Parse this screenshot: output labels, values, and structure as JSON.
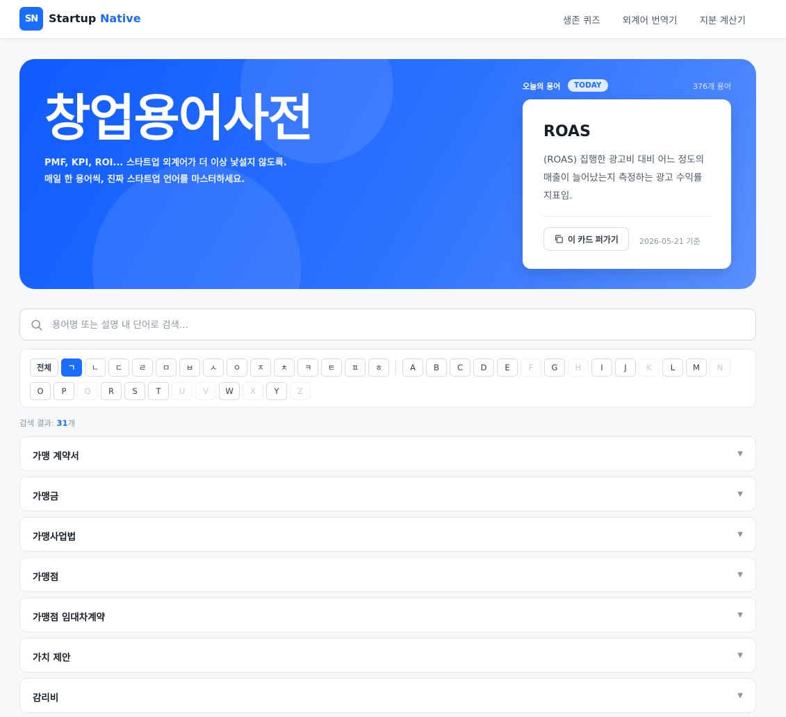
{
  "header": {
    "logo_text": "SN",
    "brand_main": "Startup",
    "brand_accent": "Native",
    "nav": [
      "생존 퀴즈",
      "외계어 번역기",
      "지분 계산기"
    ]
  },
  "hero": {
    "title": "창업용어사전",
    "subtitle_line1": "PMF, KPI, ROI... 스타트업 외계어가 더 이상 낯설지 않도록.",
    "subtitle_line2": "매일 한 용어씩, 진짜 스타트업 언어를 마스터하세요.",
    "today_label": "오늘의 용어",
    "today_badge": "TODAY",
    "term_count": "376개 용어",
    "card": {
      "term": "ROAS",
      "description": "(ROAS) 집행한 광고비 대비 어느 정도의 매출이 늘어났는지 측정하는 광고 수익률 지표임.",
      "share_label": "이 카드 퍼가기",
      "date": "2026-05-21 기준"
    }
  },
  "search": {
    "placeholder": "용어명 또는 설명 내 단어로 검색...",
    "value": ""
  },
  "filters": {
    "all_label": "전체",
    "selected": "ㄱ",
    "korean": [
      "ㄱ",
      "ㄴ",
      "ㄷ",
      "ㄹ",
      "ㅁ",
      "ㅂ",
      "ㅅ",
      "ㅇ",
      "ㅈ",
      "ㅊ",
      "ㅋ",
      "ㅌ",
      "ㅍ",
      "ㅎ"
    ],
    "alpha_row1": [
      {
        "l": "A",
        "on": true
      },
      {
        "l": "B",
        "on": true
      },
      {
        "l": "C",
        "on": true
      },
      {
        "l": "D",
        "on": true
      },
      {
        "l": "E",
        "on": true
      },
      {
        "l": "F",
        "on": false
      },
      {
        "l": "G",
        "on": true
      },
      {
        "l": "H",
        "on": false
      },
      {
        "l": "I",
        "on": true
      },
      {
        "l": "J",
        "on": true
      },
      {
        "l": "K",
        "on": false
      },
      {
        "l": "L",
        "on": true
      },
      {
        "l": "M",
        "on": true
      },
      {
        "l": "N",
        "on": false
      }
    ],
    "alpha_row2": [
      {
        "l": "O",
        "on": true
      },
      {
        "l": "P",
        "on": true
      },
      {
        "l": "Q",
        "on": false
      },
      {
        "l": "R",
        "on": true
      },
      {
        "l": "S",
        "on": true
      },
      {
        "l": "T",
        "on": true
      },
      {
        "l": "U",
        "on": false
      },
      {
        "l": "V",
        "on": false
      },
      {
        "l": "W",
        "on": true
      },
      {
        "l": "X",
        "on": false
      },
      {
        "l": "Y",
        "on": true
      },
      {
        "l": "Z",
        "on": false
      }
    ]
  },
  "results": {
    "prefix": "검색 결과: ",
    "count": "31",
    "suffix": "개",
    "items": [
      "가맹 계약서",
      "가맹금",
      "가맹사업법",
      "가맹점",
      "가맹점 임대차계약",
      "가치 제안",
      "감리비"
    ]
  },
  "colors": {
    "accent": "#1a6dff",
    "hero_start": "#0f5bff",
    "hero_end": "#5a90ff"
  }
}
